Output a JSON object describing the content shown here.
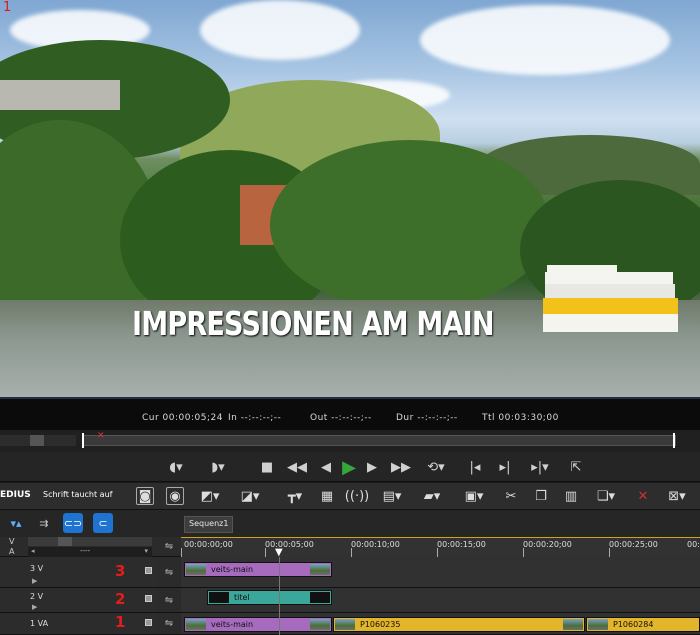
{
  "preview": {
    "corner_number": "1",
    "caption": "IMPRESSIONEN AM MAIN"
  },
  "timecode": {
    "cur": "Cur 00:00:05;24",
    "in": "In --:--:--;--",
    "out": "Out --:--:--;--",
    "dur": "Dur --:--:--;--",
    "ttl": "Ttl 00:03:30;00"
  },
  "toolbar": {
    "app_title": "EDIUS",
    "project_name": "Schrift taucht auf"
  },
  "sequence_tab": "Sequenz1",
  "ruler": {
    "ticks": [
      "00:00:00;00",
      "00:00:05;00",
      "00:00:10;00",
      "00:00:15;00",
      "00:00:20;00",
      "00:00:25;00",
      "00:00:"
    ]
  },
  "track_header": {
    "v_label": "V",
    "a_label": "A",
    "dash": "----"
  },
  "tracks": [
    {
      "label": "3 V",
      "number": "3"
    },
    {
      "label": "2 V",
      "number": "2"
    },
    {
      "label": "1 VA",
      "number": "1"
    }
  ],
  "clips": {
    "track3": "veits-main",
    "track2": "titel",
    "track1a": "veits-main",
    "track1b": "P1060235",
    "track1c": "P1060284"
  },
  "colors": {
    "clip_purple": "#a66bbd",
    "clip_teal": "#3aa79a",
    "clip_yellow": "#e3b52a",
    "track_number": "#e51c1c",
    "play_green": "#35a83a"
  }
}
